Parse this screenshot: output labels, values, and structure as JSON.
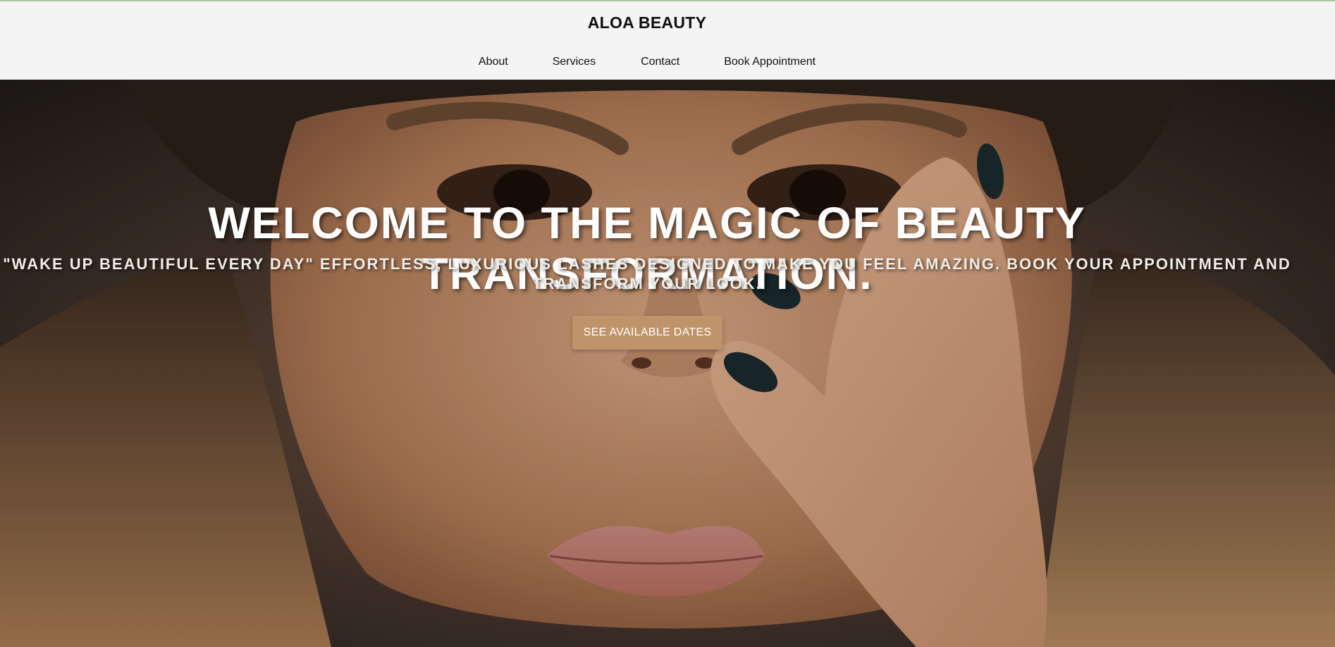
{
  "header": {
    "brand": "ALOA BEAUTY",
    "nav": [
      {
        "label": "About"
      },
      {
        "label": "Services"
      },
      {
        "label": "Contact"
      },
      {
        "label": "Book Appointment"
      }
    ]
  },
  "hero": {
    "title": "WELCOME TO THE MAGIC OF BEAUTY TRANSFORMATION.",
    "subtitle": "\"WAKE UP BEAUTIFUL EVERY DAY\" EFFORTLESS, LUXURIOUS LASHES DESIGNED TO MAKE YOU FEEL AMAZING. BOOK YOUR APPOINTMENT AND TRANSFORM YOUR LOOK.",
    "cta_label": "SEE AVAILABLE DATES"
  },
  "colors": {
    "header_bg": "#f4f4f4",
    "accent_button": "#c0946a",
    "top_border": "#a8c9a0"
  }
}
